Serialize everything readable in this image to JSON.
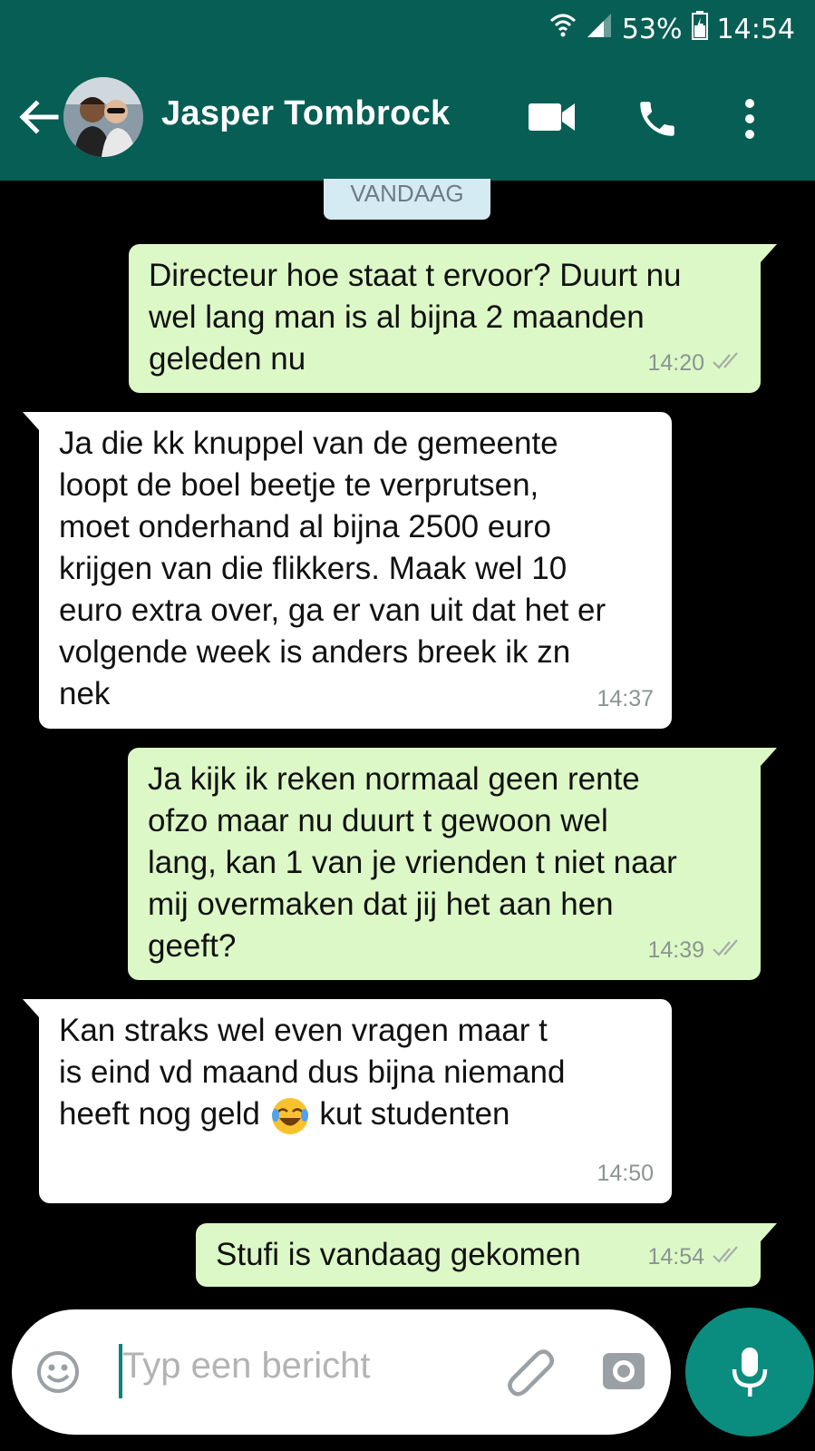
{
  "status_bar": {
    "battery": "53%",
    "time": "14:54"
  },
  "header": {
    "contact_name": "Jasper Tombrock"
  },
  "chat": {
    "date_label": "VANDAAG",
    "messages": [
      {
        "direction": "out",
        "text": "Directeur hoe staat t ervoor? Duurt nu\nwel lang man is al bijna 2 maanden\ngeleden nu",
        "time": "14:20"
      },
      {
        "direction": "in",
        "text": "Ja die kk knuppel van de gemeente\nloopt de boel beetje te verprutsen,\nmoet onderhand al bijna 2500 euro\nkrijgen van die flikkers. Maak wel 10\neuro extra over, ga er van uit dat het er\nvolgende week is anders breek ik zn\nnek",
        "time": "14:37"
      },
      {
        "direction": "out",
        "text": "Ja kijk ik reken normaal geen rente\nofzo maar nu duurt t gewoon wel\nlang, kan 1 van je vrienden t niet naar\nmij overmaken dat jij het aan hen\ngeeft?",
        "time": "14:39"
      },
      {
        "direction": "in",
        "text_before": "Kan straks wel even vragen maar t\nis eind vd maand dus bijna niemand\nheeft nog geld",
        "emoji": "face-with-tears-of-joy-icon",
        "text_after": "kut studenten",
        "time": "14:50"
      },
      {
        "direction": "out",
        "text": "Stufi is vandaag gekomen",
        "time": "14:54"
      }
    ]
  },
  "composer": {
    "placeholder": "Typ een bericht"
  },
  "icons": [
    "back-arrow-icon",
    "video-call-icon",
    "phone-icon",
    "more-vert-icon",
    "emoji-icon",
    "attach-icon",
    "camera-icon",
    "mic-icon",
    "double-check-icon",
    "wifi-icon",
    "signal-icon",
    "battery-icon"
  ],
  "colors": {
    "header": "#075e54",
    "outgoing_bubble": "#dcf8c6",
    "incoming_bubble": "#ffffff",
    "date_chip": "#d5ebf4",
    "mic_button": "#0a8d7e",
    "chat_background": "#000000"
  }
}
